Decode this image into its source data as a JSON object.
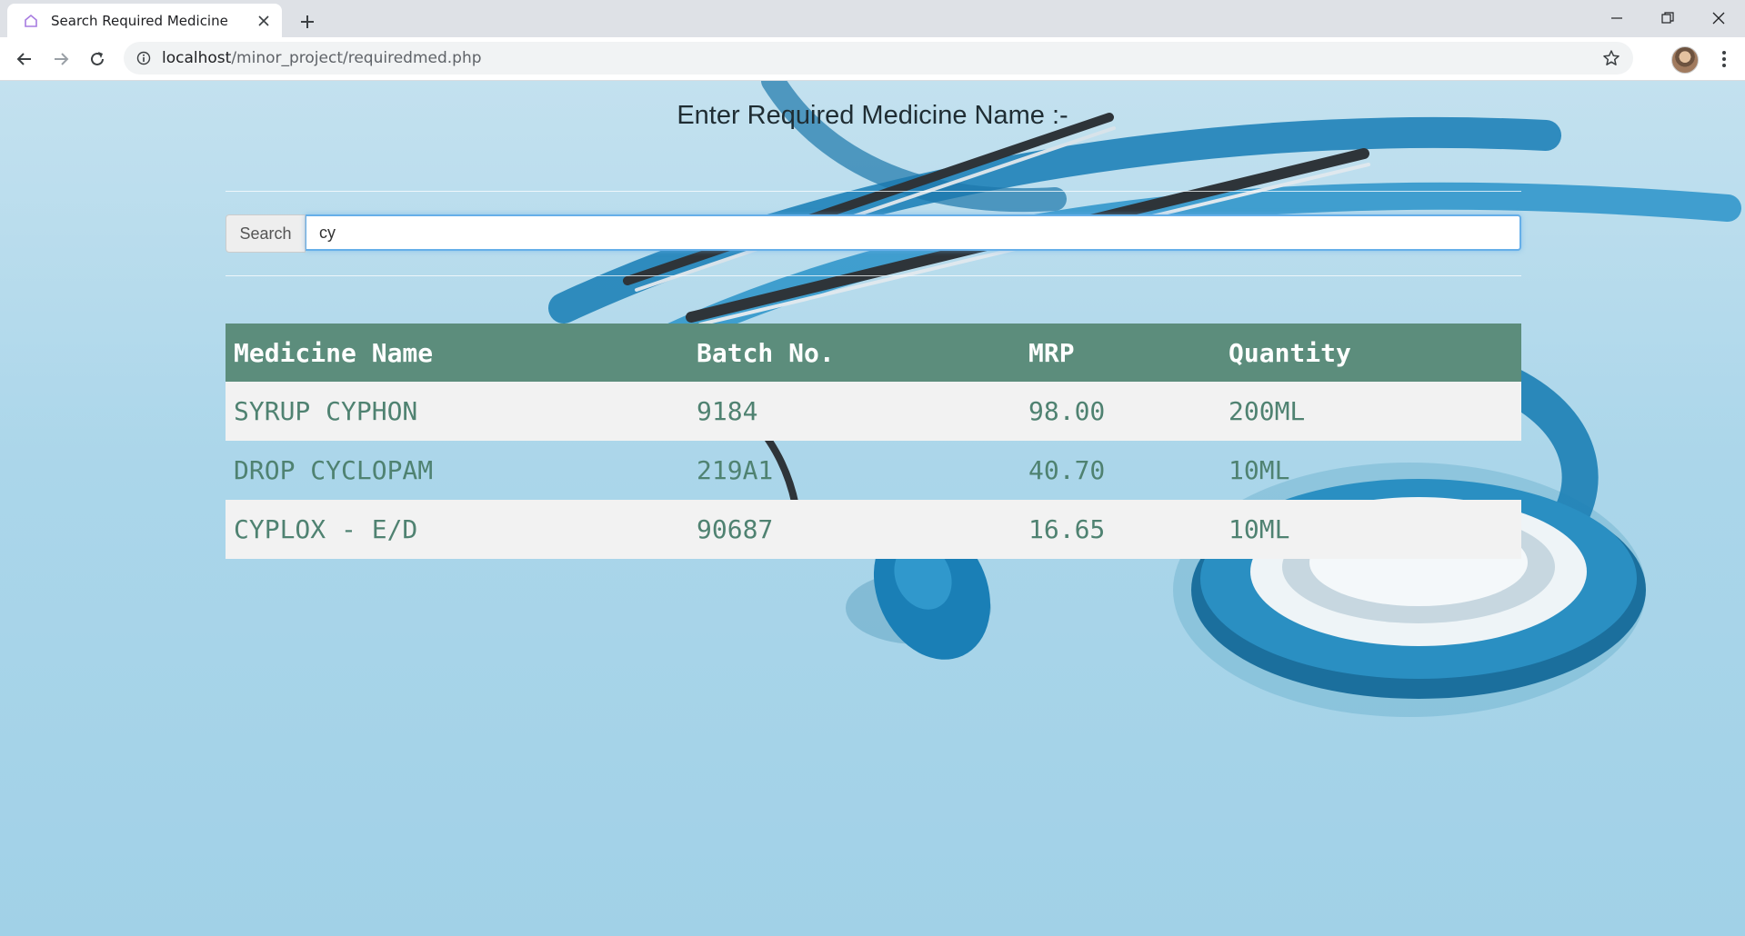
{
  "browser": {
    "tab_title": "Search Required Medicine",
    "url_host": "localhost",
    "url_path": "/minor_project/requiredmed.php",
    "icons": {
      "favicon": "home-icon",
      "close": "close-icon",
      "new_tab": "plus-icon",
      "minimize": "minimize-icon",
      "restore": "restore-icon",
      "window_close": "close-icon",
      "back": "arrow-left-icon",
      "forward": "arrow-right-icon",
      "reload": "reload-icon",
      "site_info": "info-icon",
      "bookmark": "star-icon",
      "menu": "more-vert-icon"
    }
  },
  "page": {
    "heading": "Enter Required Medicine Name :-",
    "search": {
      "addon_label": "Search",
      "value": "cy"
    },
    "table": {
      "header_color": "#5c8d7c",
      "text_color": "#4f8271",
      "columns": [
        "Medicine Name",
        "Batch No.",
        "MRP",
        "Quantity"
      ],
      "rows": [
        [
          "SYRUP CYPHON",
          "9184",
          "98.00",
          "200ML"
        ],
        [
          "DROP CYCLOPAM",
          "219A1",
          "40.70",
          "10ML"
        ],
        [
          "CYPLOX - E/D",
          "90687",
          "16.65",
          "10ML"
        ]
      ]
    }
  }
}
